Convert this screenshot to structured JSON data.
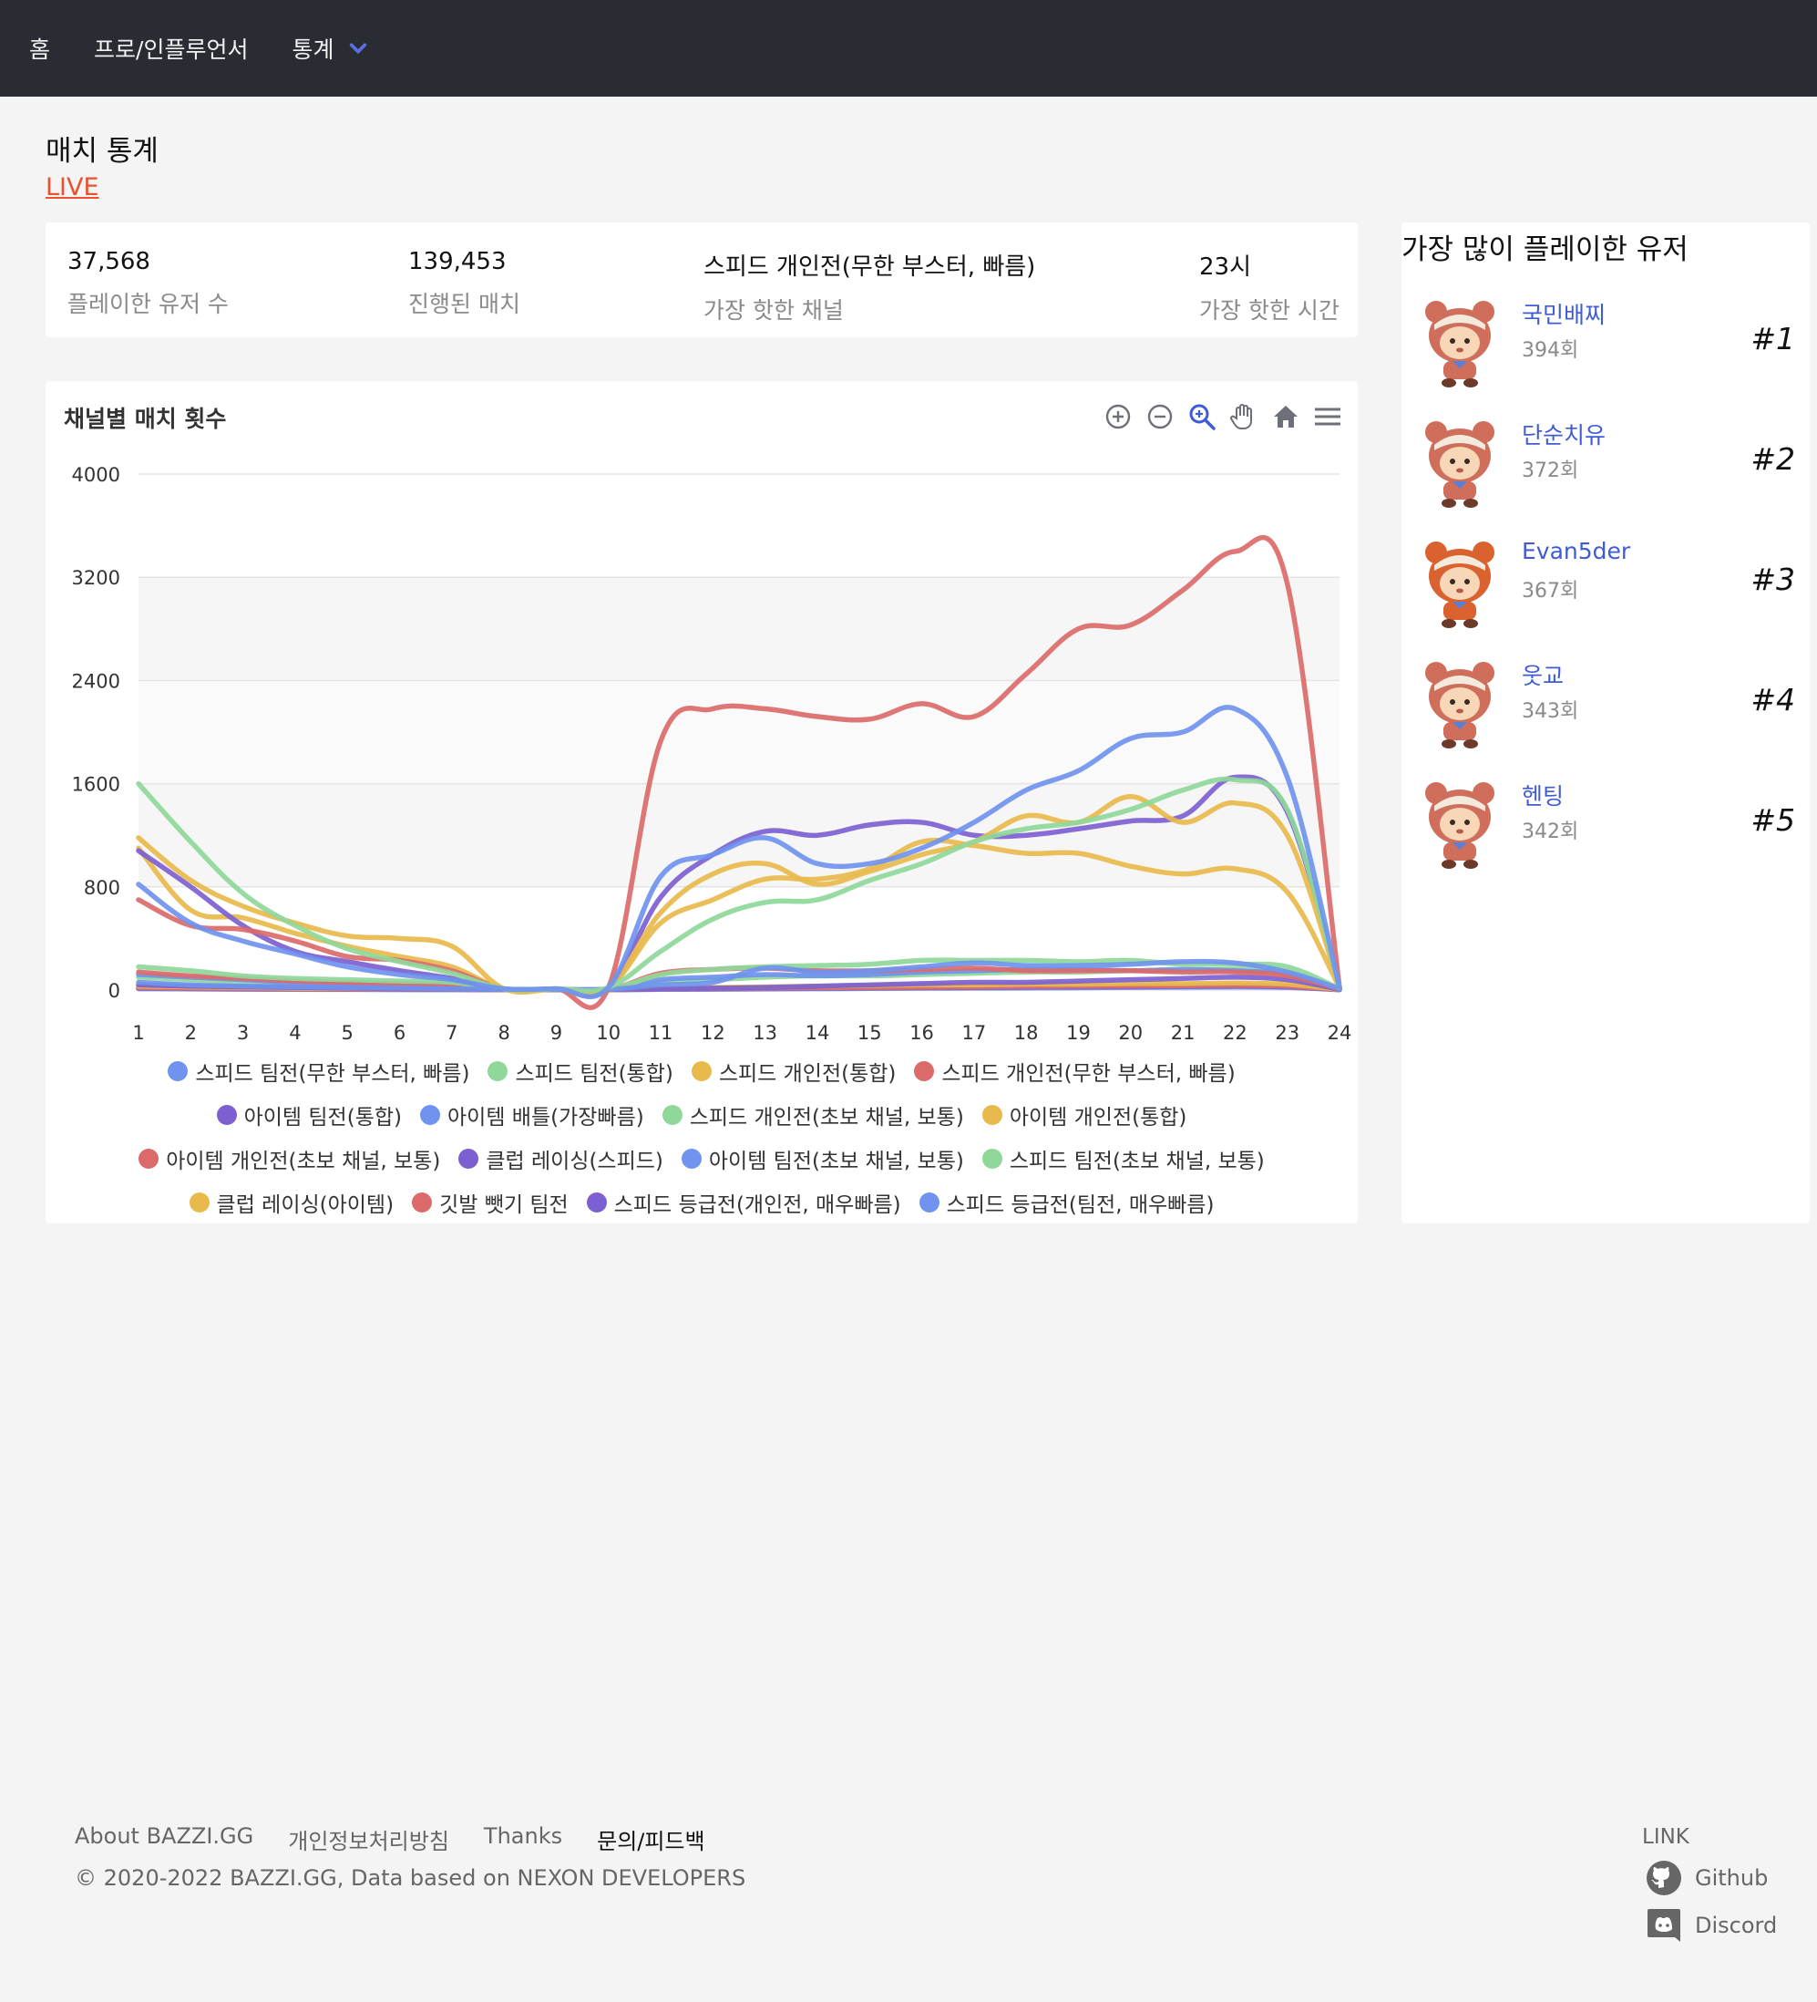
{
  "nav": {
    "home": "홈",
    "pro": "프로/인플루언서",
    "stats": "통계"
  },
  "page": {
    "title": "매치 통계",
    "live": "LIVE"
  },
  "stats": [
    {
      "value": "37,568",
      "label": "플레이한 유저 수"
    },
    {
      "value": "139,453",
      "label": "진행된 매치"
    },
    {
      "value": "스피드 개인전(무한 부스터, 빠름)",
      "label": "가장 핫한 채널"
    },
    {
      "value": "23시",
      "label": "가장 핫한 시간"
    }
  ],
  "chart_card": {
    "title": "채널별 매치 횟수",
    "toolbar": [
      "zoom-in-icon",
      "zoom-out-icon",
      "selection-zoom-icon",
      "pan-icon",
      "reset-home-icon",
      "menu-icon"
    ]
  },
  "ranking": {
    "title": "가장 많이 플레이한 유저",
    "users": [
      {
        "name": "국민배찌",
        "count": "394회",
        "rank": "#1"
      },
      {
        "name": "단순치유",
        "count": "372회",
        "rank": "#2"
      },
      {
        "name": "Evan5der",
        "count": "367회",
        "rank": "#3"
      },
      {
        "name": "웃교",
        "count": "343회",
        "rank": "#4"
      },
      {
        "name": "헨팅",
        "count": "342회",
        "rank": "#5"
      }
    ]
  },
  "footer": {
    "links": [
      "About BAZZI.GG",
      "개인정보처리방침",
      "Thanks",
      "문의/피드백"
    ],
    "copyright": "© 2020-2022 BAZZI.GG, Data based on NEXON DEVELOPERS",
    "link_heading": "LINK",
    "github": "Github",
    "discord": "Discord"
  },
  "chart_data": {
    "type": "line",
    "x": [
      1,
      2,
      3,
      4,
      5,
      6,
      7,
      8,
      9,
      10,
      11,
      12,
      13,
      14,
      15,
      16,
      17,
      18,
      19,
      20,
      21,
      22,
      23,
      24
    ],
    "ylim": [
      0,
      4000
    ],
    "yticks": [
      0,
      800,
      1600,
      2400,
      3200,
      4000
    ],
    "series": [
      {
        "name": "스피드 팀전(무한 부스터, 빠름)",
        "color": "#6f93ee",
        "values": [
          820,
          520,
          380,
          280,
          180,
          120,
          80,
          10,
          10,
          20,
          880,
          1050,
          1180,
          980,
          980,
          1100,
          1300,
          1550,
          1700,
          1950,
          2000,
          2180,
          1650,
          20
        ]
      },
      {
        "name": "스피드 팀전(통합)",
        "color": "#8fd89a",
        "values": [
          1600,
          1150,
          750,
          500,
          320,
          220,
          130,
          10,
          10,
          20,
          300,
          550,
          680,
          700,
          850,
          980,
          1150,
          1250,
          1300,
          1400,
          1550,
          1630,
          1400,
          20
        ]
      },
      {
        "name": "스피드 개인전(통합)",
        "color": "#e8ba4c",
        "values": [
          1180,
          850,
          650,
          520,
          420,
          400,
          340,
          10,
          10,
          20,
          600,
          900,
          980,
          820,
          920,
          1050,
          1150,
          1350,
          1300,
          1500,
          1300,
          1450,
          1200,
          20
        ]
      },
      {
        "name": "스피드 개인전(무한 부스터, 빠름)",
        "color": "#dc6a6a",
        "values": [
          700,
          500,
          470,
          380,
          260,
          230,
          150,
          10,
          10,
          20,
          1930,
          2180,
          2180,
          2120,
          2100,
          2220,
          2120,
          2450,
          2800,
          2830,
          3100,
          3400,
          3150,
          20
        ]
      },
      {
        "name": "아이템 팀전(통합)",
        "color": "#7c5fd0",
        "values": [
          1080,
          800,
          500,
          300,
          220,
          150,
          90,
          10,
          10,
          20,
          720,
          1050,
          1230,
          1200,
          1280,
          1300,
          1200,
          1200,
          1250,
          1310,
          1350,
          1650,
          1380,
          20
        ]
      },
      {
        "name": "아이템 배틀(가장빠름)",
        "color": "#6f93ee",
        "values": [
          60,
          40,
          30,
          25,
          20,
          15,
          10,
          5,
          5,
          5,
          40,
          60,
          170,
          140,
          150,
          180,
          210,
          190,
          190,
          200,
          220,
          210,
          140,
          10
        ]
      },
      {
        "name": "스피드 개인전(초보 채널, 보통)",
        "color": "#8fd89a",
        "values": [
          180,
          150,
          110,
          90,
          80,
          70,
          60,
          5,
          5,
          5,
          120,
          160,
          180,
          190,
          200,
          230,
          230,
          230,
          220,
          230,
          200,
          200,
          180,
          10
        ]
      },
      {
        "name": "아이템 개인전(통합)",
        "color": "#e8ba4c",
        "values": [
          1100,
          620,
          560,
          440,
          340,
          260,
          180,
          10,
          10,
          20,
          520,
          700,
          860,
          860,
          940,
          1150,
          1120,
          1060,
          1060,
          960,
          900,
          940,
          760,
          20
        ]
      },
      {
        "name": "아이템 개인전(초보 채널, 보통)",
        "color": "#dc6a6a",
        "values": [
          140,
          110,
          90,
          70,
          60,
          50,
          40,
          5,
          5,
          5,
          130,
          160,
          170,
          150,
          150,
          160,
          170,
          150,
          150,
          150,
          140,
          140,
          110,
          10
        ]
      },
      {
        "name": "클럽 레이싱(스피드)",
        "color": "#7c5fd0",
        "values": [
          40,
          30,
          25,
          20,
          15,
          10,
          8,
          4,
          4,
          4,
          10,
          15,
          20,
          30,
          40,
          50,
          60,
          60,
          70,
          80,
          90,
          100,
          80,
          5
        ]
      },
      {
        "name": "아이템 팀전(초보 채널, 보통)",
        "color": "#6f93ee",
        "values": [
          120,
          100,
          80,
          60,
          50,
          40,
          30,
          5,
          5,
          5,
          80,
          100,
          120,
          110,
          120,
          140,
          150,
          160,
          160,
          150,
          160,
          150,
          120,
          10
        ]
      },
      {
        "name": "스피드 팀전(초보 채널, 보통)",
        "color": "#8fd89a",
        "values": [
          100,
          80,
          60,
          50,
          40,
          30,
          25,
          5,
          5,
          5,
          60,
          80,
          100,
          110,
          110,
          120,
          130,
          140,
          140,
          150,
          150,
          160,
          140,
          10
        ]
      },
      {
        "name": "클럽 레이싱(아이템)",
        "color": "#e8ba4c",
        "values": [
          30,
          25,
          20,
          15,
          12,
          10,
          8,
          3,
          3,
          3,
          15,
          20,
          25,
          30,
          35,
          40,
          40,
          45,
          45,
          50,
          50,
          55,
          45,
          5
        ]
      },
      {
        "name": "깃발 뺏기 팀전",
        "color": "#dc6a6a",
        "values": [
          20,
          15,
          12,
          10,
          8,
          6,
          5,
          2,
          2,
          2,
          10,
          12,
          15,
          18,
          20,
          22,
          25,
          28,
          30,
          32,
          34,
          36,
          30,
          3
        ]
      },
      {
        "name": "스피드 등급전(개인전, 매우빠름)",
        "color": "#7c5fd0",
        "values": [
          15,
          12,
          10,
          8,
          6,
          5,
          4,
          2,
          2,
          2,
          8,
          10,
          12,
          14,
          16,
          18,
          20,
          22,
          24,
          26,
          28,
          30,
          25,
          3
        ]
      },
      {
        "name": "스피드 등급전(팀전, 매우빠름)",
        "color": "#6f93ee",
        "values": [
          10,
          8,
          6,
          5,
          4,
          3,
          3,
          1,
          1,
          1,
          5,
          6,
          8,
          10,
          12,
          14,
          15,
          16,
          18,
          20,
          22,
          24,
          20,
          2
        ]
      }
    ]
  }
}
